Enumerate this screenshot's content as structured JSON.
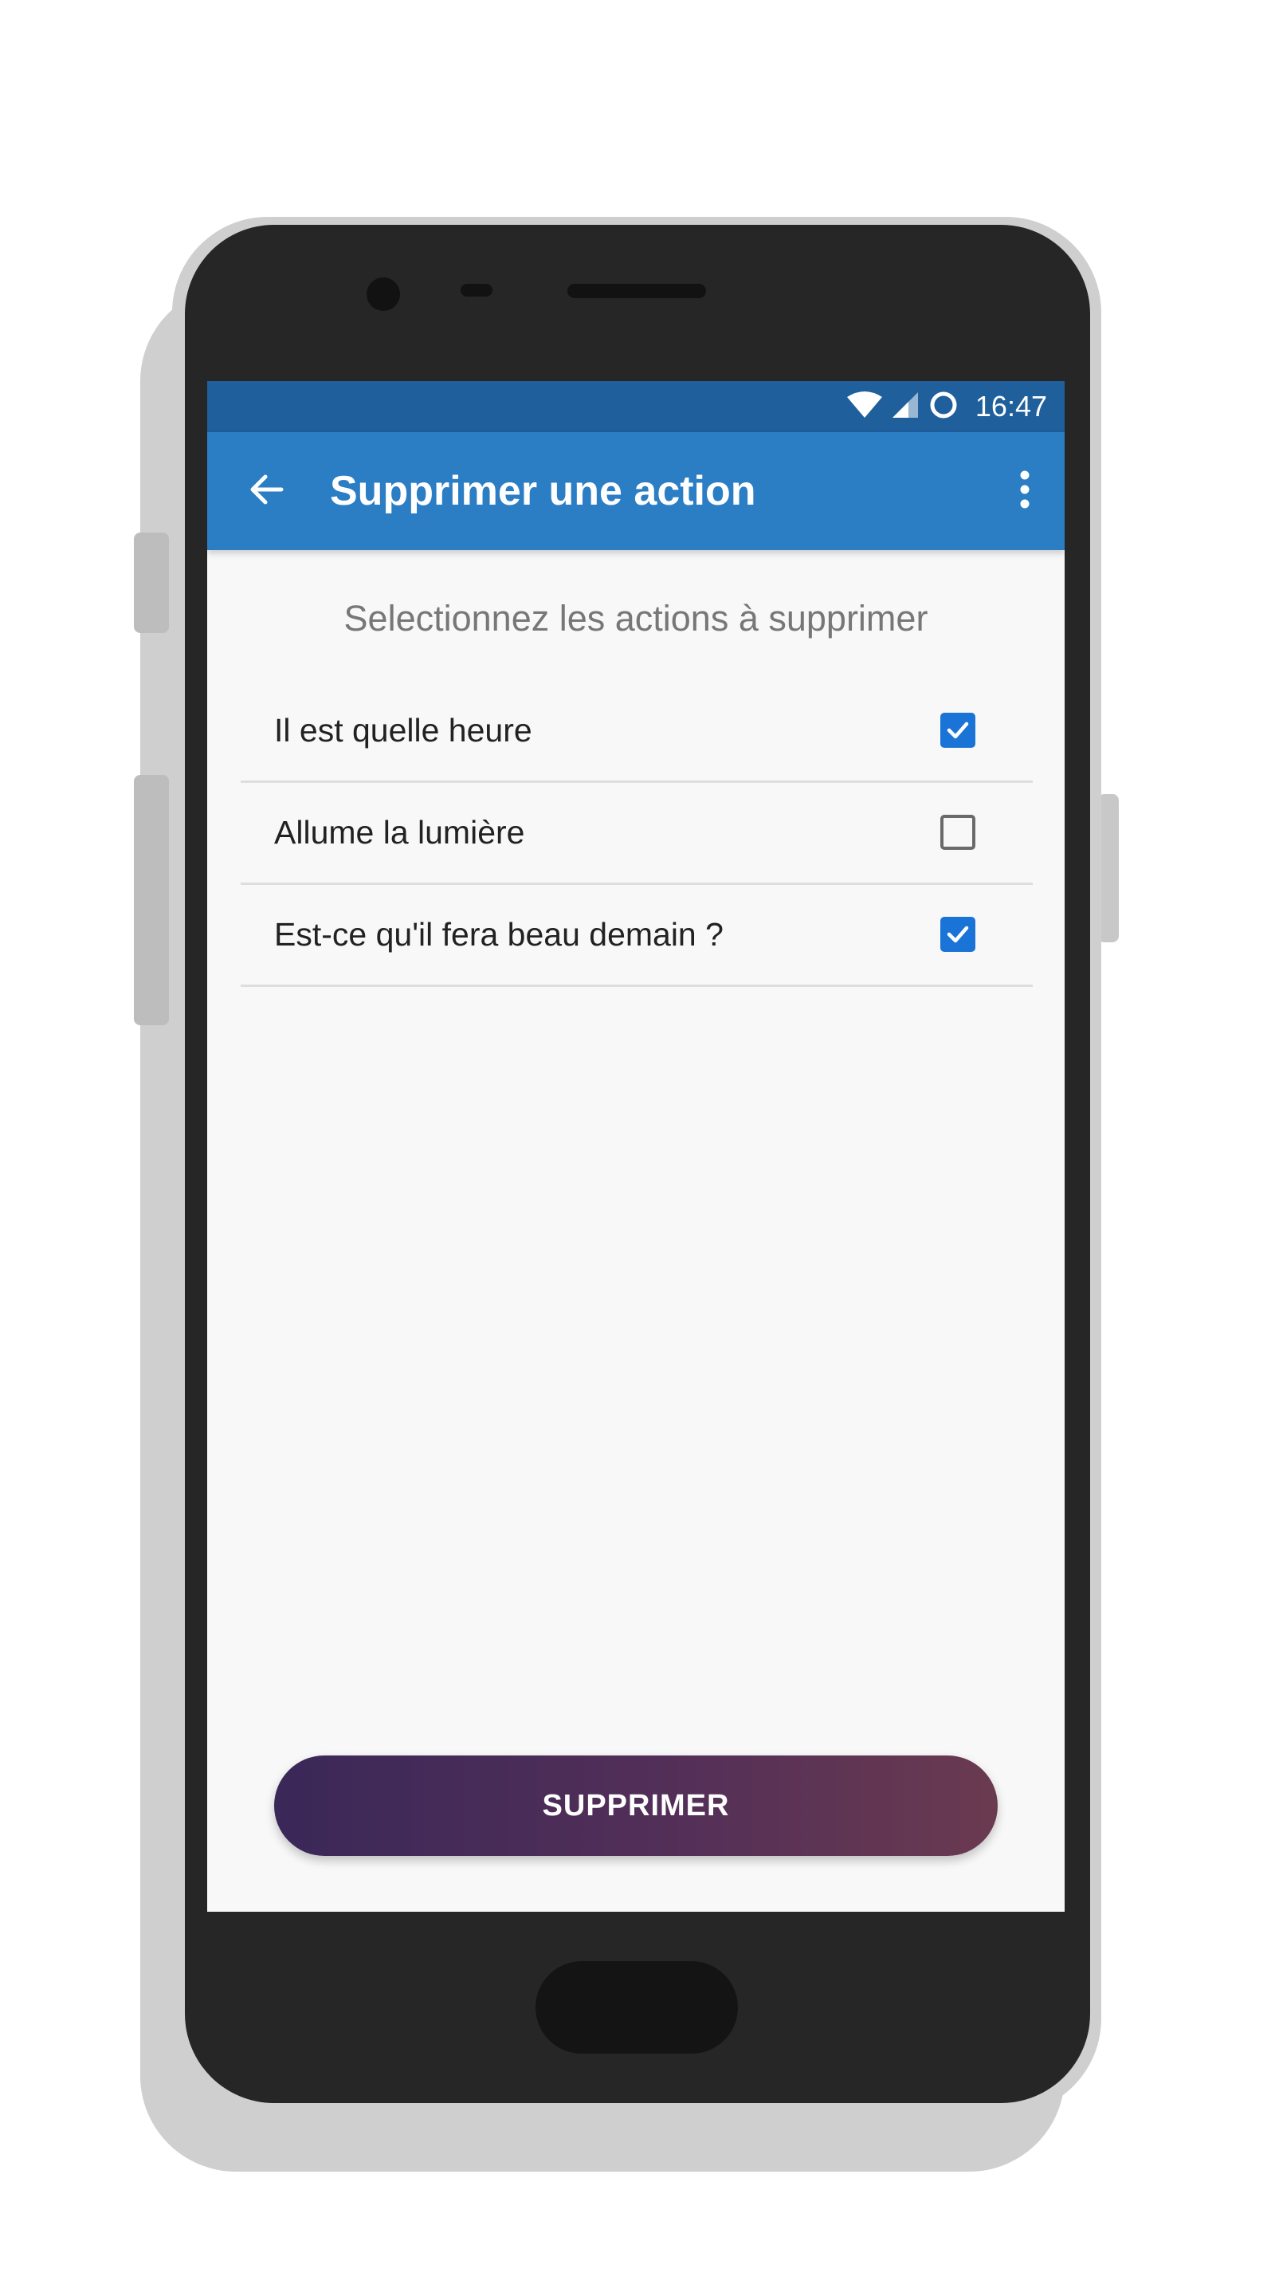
{
  "status_bar": {
    "time": "16:47",
    "icons": [
      "wifi-icon",
      "signal-icon",
      "circle-notification-icon"
    ]
  },
  "app_bar": {
    "title": "Supprimer une action",
    "back_icon": "arrow-back-icon",
    "menu_icon": "more-vert-icon",
    "color": "#2b7dc4"
  },
  "main": {
    "instruction": "Selectionnez les actions à supprimer",
    "actions": [
      {
        "label": "Il est quelle heure",
        "checked": true
      },
      {
        "label": "Allume la lumière",
        "checked": false
      },
      {
        "label": "Est-ce qu'il fera beau demain ?",
        "checked": true
      }
    ],
    "delete_button_label": "SUPPRIMER"
  },
  "colors": {
    "status_bar": "#1e5f9c",
    "accent": "#1a73d6",
    "button_gradient_start": "#3a2858",
    "button_gradient_end": "#6a3a50"
  }
}
